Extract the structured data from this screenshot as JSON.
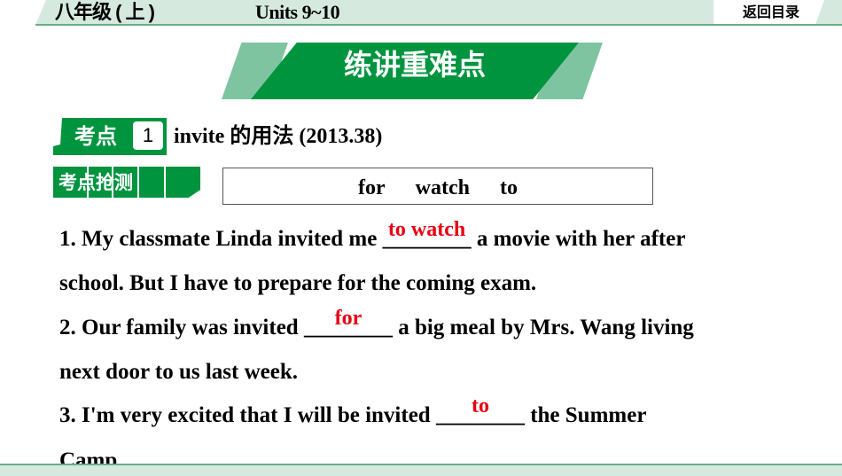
{
  "header": {
    "grade": "八年级 ( 上 )",
    "units": "Units 9~10",
    "back_label": "返回目录"
  },
  "banner": {
    "title": "练讲重难点"
  },
  "point": {
    "label": "考点",
    "number": "1",
    "topic": "invite 的用法 (2013.38)"
  },
  "test": {
    "label": "考点抢测",
    "words": [
      "for",
      "watch",
      "to"
    ]
  },
  "questions": [
    {
      "before": "1. My classmate Linda invited me ",
      "blank": "________",
      "answer": "to watch",
      "after": " a movie with her after",
      "cont": "school. But I have to prepare for the coming exam."
    },
    {
      "before": "2. Our family was invited ",
      "blank": "________",
      "answer": "for",
      "after": " a big meal by Mrs. Wang living",
      "cont": "next door to us last week."
    },
    {
      "before": "3. I'm very excited that I will be invited ",
      "blank": "________",
      "answer": "to",
      "after": " the Summer",
      "cont": "Camp."
    }
  ],
  "colors": {
    "green": "#00943f",
    "light_green": "#7fc4a0",
    "band": "#d5e9df",
    "answer": "#e60012"
  }
}
